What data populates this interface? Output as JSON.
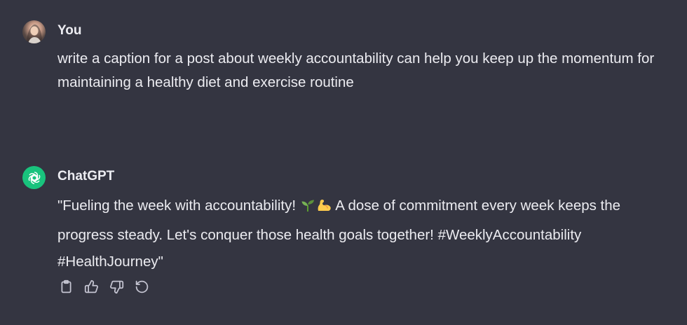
{
  "user_message": {
    "author": "You",
    "text": "write a caption for a post about weekly accountability can help you keep up the momentum for maintaining a healthy diet and exercise routine"
  },
  "assistant_message": {
    "author": "ChatGPT",
    "text_before_emoji": "\"Fueling the week with accountability! ",
    "emojis": [
      "seedling-emoji",
      "flexed-biceps-emoji"
    ],
    "text_after_emoji": " A dose of commitment every week keeps the progress steady. Let's conquer those health goals together! #WeeklyAccountability #HealthJourney\""
  },
  "actions": [
    {
      "icon": "clipboard-icon"
    },
    {
      "icon": "thumbs-up-icon"
    },
    {
      "icon": "thumbs-down-icon"
    },
    {
      "icon": "regenerate-icon"
    }
  ],
  "colors": {
    "background": "#343541",
    "text": "#ececf1",
    "icon": "#c5c5d2",
    "chatgpt_avatar": "#19c37d"
  }
}
